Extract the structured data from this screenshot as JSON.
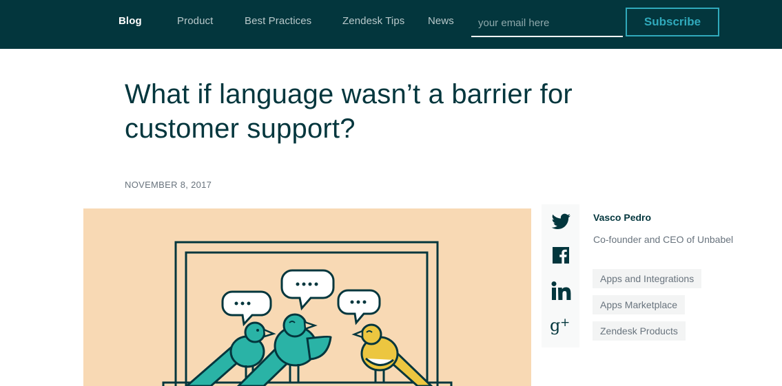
{
  "nav": {
    "items": [
      {
        "label": "Blog",
        "active": true
      },
      {
        "label": "Product",
        "active": false
      },
      {
        "label": "Best Practices",
        "active": false
      },
      {
        "label": "Zendesk Tips",
        "active": false
      },
      {
        "label": "News",
        "active": false
      }
    ],
    "email_placeholder": "your email here",
    "subscribe_label": "Subscribe"
  },
  "article": {
    "title": "What if language wasn’t a barrier for customer support?",
    "date": "NOVEMBER 8, 2017"
  },
  "share": {
    "icons": [
      "twitter-icon",
      "facebook-icon",
      "linkedin-icon",
      "google-plus-icon"
    ]
  },
  "author": {
    "name": "Vasco Pedro",
    "role": "Co-founder and CEO of Unbabel"
  },
  "tags": [
    "Apps and Integrations",
    "Apps Marketplace",
    "Zendesk Products"
  ],
  "colors": {
    "topbar": "#03363d",
    "accent": "#30aabc",
    "hero_bg": "#f8d9b4",
    "bird_teal": "#2ab3a6",
    "bird_yellow": "#ecc640"
  }
}
